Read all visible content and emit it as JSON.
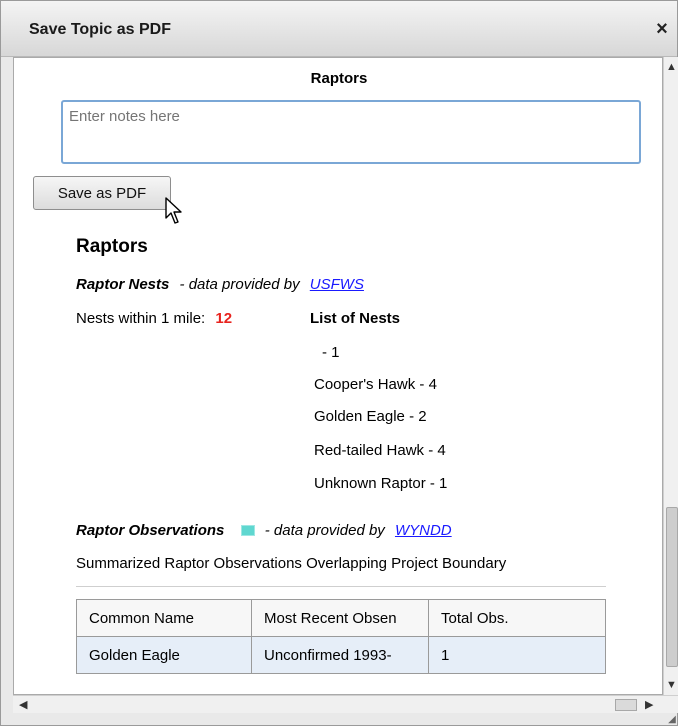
{
  "window": {
    "title": "Save Topic as PDF",
    "close_glyph": "×"
  },
  "page": {
    "heading": "Raptors",
    "notes_placeholder": "Enter notes here",
    "save_button_label": "Save as PDF"
  },
  "report": {
    "section_title": "Raptors",
    "nests": {
      "label": "Raptor Nests",
      "provided_by_text": "- data provided by",
      "provider": "USFWS",
      "within_label": "Nests within 1 mile:",
      "count": "12",
      "list_title": "List of Nests",
      "items": [
        "- 1",
        "Cooper's Hawk - 4",
        "Golden Eagle - 2",
        "Red-tailed Hawk - 4",
        "Unknown Raptor - 1"
      ]
    },
    "observations": {
      "label": "Raptor Observations",
      "legend_icon": "map-legend-icon",
      "legend_color": "#5fd7d0",
      "provided_by_text": "- data provided by",
      "provider": "WYNDD",
      "summary": "Summarized Raptor Observations Overlapping Project Boundary",
      "table": {
        "headers": [
          "Common Name",
          "Most Recent Obsen",
          "Total Obs."
        ],
        "rows": [
          [
            "Golden Eagle",
            "Unconfirmed 1993-",
            "1"
          ]
        ]
      }
    }
  },
  "colors": {
    "count": "#e8231e",
    "link": "#1a1aff",
    "input_border": "#7aa7d6"
  }
}
